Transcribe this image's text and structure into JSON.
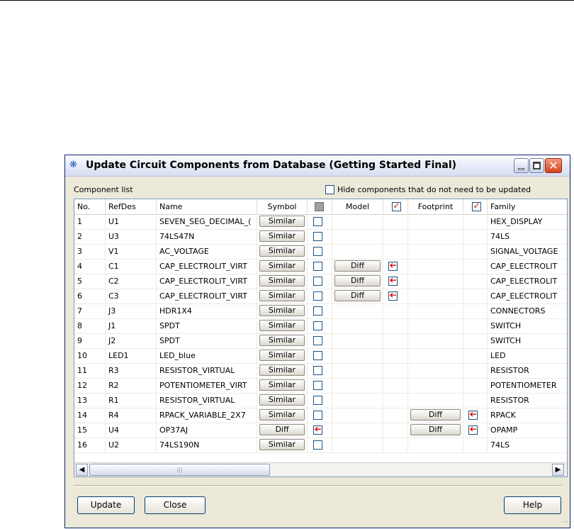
{
  "window": {
    "title": "Update Circuit Components from Database (Getting Started Final)"
  },
  "component_list_label": "Component list",
  "hide_checkbox_label": "Hide components that do not need to be updated",
  "columns": {
    "no": "No.",
    "refdes": "RefDes",
    "name": "Name",
    "symbol": "Symbol",
    "model": "Model",
    "footprint": "Footprint",
    "family": "Family"
  },
  "rows": [
    {
      "no": "1",
      "refdes": "U1",
      "name": "SEVEN_SEG_DECIMAL_(",
      "symbol": "Similar",
      "symbol_checked": false,
      "model": "",
      "model_checked": false,
      "footprint": "",
      "footprint_checked": false,
      "family": "HEX_DISPLAY"
    },
    {
      "no": "2",
      "refdes": "U3",
      "name": "74LS47N",
      "symbol": "Similar",
      "symbol_checked": false,
      "model": "",
      "model_checked": false,
      "footprint": "",
      "footprint_checked": false,
      "family": "74LS"
    },
    {
      "no": "3",
      "refdes": "V1",
      "name": "AC_VOLTAGE",
      "symbol": "Similar",
      "symbol_checked": false,
      "model": "",
      "model_checked": false,
      "footprint": "",
      "footprint_checked": false,
      "family": "SIGNAL_VOLTAGE"
    },
    {
      "no": "4",
      "refdes": "C1",
      "name": "CAP_ELECTROLIT_VIRT",
      "symbol": "Similar",
      "symbol_checked": false,
      "model": "Diff",
      "model_checked": true,
      "footprint": "",
      "footprint_checked": false,
      "family": "CAP_ELECTROLIT"
    },
    {
      "no": "5",
      "refdes": "C2",
      "name": "CAP_ELECTROLIT_VIRT",
      "symbol": "Similar",
      "symbol_checked": false,
      "model": "Diff",
      "model_checked": true,
      "footprint": "",
      "footprint_checked": false,
      "family": "CAP_ELECTROLIT"
    },
    {
      "no": "6",
      "refdes": "C3",
      "name": "CAP_ELECTROLIT_VIRT",
      "symbol": "Similar",
      "symbol_checked": false,
      "model": "Diff",
      "model_checked": true,
      "footprint": "",
      "footprint_checked": false,
      "family": "CAP_ELECTROLIT"
    },
    {
      "no": "7",
      "refdes": "J3",
      "name": "HDR1X4",
      "symbol": "Similar",
      "symbol_checked": false,
      "model": "",
      "model_checked": false,
      "footprint": "",
      "footprint_checked": false,
      "family": "CONNECTORS"
    },
    {
      "no": "8",
      "refdes": "J1",
      "name": "SPDT",
      "symbol": "Similar",
      "symbol_checked": false,
      "model": "",
      "model_checked": false,
      "footprint": "",
      "footprint_checked": false,
      "family": "SWITCH"
    },
    {
      "no": "9",
      "refdes": "J2",
      "name": "SPDT",
      "symbol": "Similar",
      "symbol_checked": false,
      "model": "",
      "model_checked": false,
      "footprint": "",
      "footprint_checked": false,
      "family": "SWITCH"
    },
    {
      "no": "10",
      "refdes": "LED1",
      "name": "LED_blue",
      "symbol": "Similar",
      "symbol_checked": false,
      "model": "",
      "model_checked": false,
      "footprint": "",
      "footprint_checked": false,
      "family": "LED"
    },
    {
      "no": "11",
      "refdes": "R3",
      "name": "RESISTOR_VIRTUAL",
      "symbol": "Similar",
      "symbol_checked": false,
      "model": "",
      "model_checked": false,
      "footprint": "",
      "footprint_checked": false,
      "family": "RESISTOR"
    },
    {
      "no": "12",
      "refdes": "R2",
      "name": "POTENTIOMETER_VIRT",
      "symbol": "Similar",
      "symbol_checked": false,
      "model": "",
      "model_checked": false,
      "footprint": "",
      "footprint_checked": false,
      "family": "POTENTIOMETER"
    },
    {
      "no": "13",
      "refdes": "R1",
      "name": "RESISTOR_VIRTUAL",
      "symbol": "Similar",
      "symbol_checked": false,
      "model": "",
      "model_checked": false,
      "footprint": "",
      "footprint_checked": false,
      "family": "RESISTOR"
    },
    {
      "no": "14",
      "refdes": "R4",
      "name": "RPACK_VARIABLE_2X7",
      "symbol": "Similar",
      "symbol_checked": false,
      "model": "",
      "model_checked": false,
      "footprint": "Diff",
      "footprint_checked": true,
      "family": "RPACK"
    },
    {
      "no": "15",
      "refdes": "U4",
      "name": "OP37AJ",
      "symbol": "Diff",
      "symbol_checked": true,
      "model": "",
      "model_checked": false,
      "footprint": "Diff",
      "footprint_checked": true,
      "family": "OPAMP"
    },
    {
      "no": "16",
      "refdes": "U2",
      "name": "74LS190N",
      "symbol": "Similar",
      "symbol_checked": false,
      "model": "",
      "model_checked": false,
      "footprint": "",
      "footprint_checked": false,
      "family": "74LS"
    }
  ],
  "buttons": {
    "update": "Update",
    "close": "Close",
    "help": "Help"
  },
  "icons": {
    "app": "component-chip-icon",
    "check_mark": "red-arrow-check-icon"
  },
  "colors": {
    "check_mark": "#e00000",
    "titlebar_close": "#d8431b"
  }
}
